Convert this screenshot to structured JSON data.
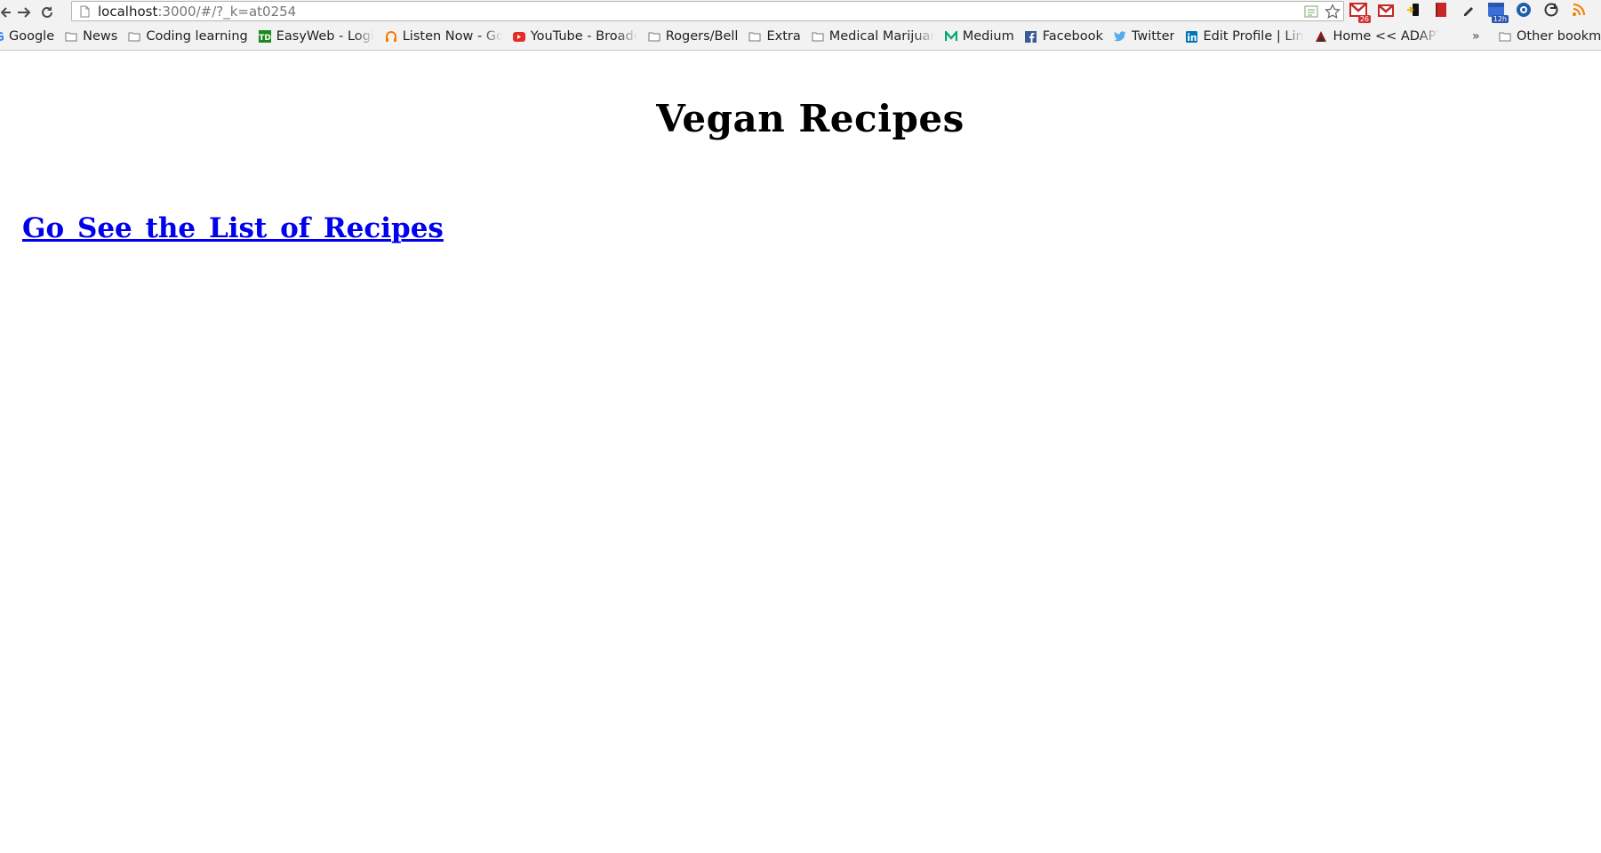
{
  "browser": {
    "url_host": "localhost",
    "url_rest": ":3000/#/?_k=at0254",
    "extensions": [
      {
        "name": "gmail",
        "badge": "26"
      },
      {
        "name": "gmail-alt"
      },
      {
        "name": "usb"
      },
      {
        "name": "book"
      },
      {
        "name": "pen"
      },
      {
        "name": "calendar",
        "badge": "12h"
      },
      {
        "name": "eye"
      },
      {
        "name": "sync"
      },
      {
        "name": "rss"
      }
    ],
    "colors": {
      "chrome_bg": "#f2f2f2",
      "link": "#0000ee"
    }
  },
  "bookmarks": {
    "items": [
      {
        "label": "Google",
        "icon": "google-icon"
      },
      {
        "label": "News",
        "icon": "folder-icon"
      },
      {
        "label": "Coding learning",
        "icon": "folder-icon"
      },
      {
        "label": "EasyWeb - Login I",
        "icon": "td-icon"
      },
      {
        "label": "Listen Now - Goo",
        "icon": "headphones-icon"
      },
      {
        "label": "YouTube - Broadc",
        "icon": "youtube-icon"
      },
      {
        "label": "Rogers/Bell",
        "icon": "folder-icon"
      },
      {
        "label": "Extra",
        "icon": "folder-icon"
      },
      {
        "label": "Medical Marijuan",
        "icon": "folder-icon"
      },
      {
        "label": "Medium",
        "icon": "medium-icon"
      },
      {
        "label": "Facebook",
        "icon": "facebook-icon"
      },
      {
        "label": "Twitter",
        "icon": "twitter-icon"
      },
      {
        "label": "Edit Profile | Link",
        "icon": "linkedin-icon"
      },
      {
        "label": "Home << ADAPTT",
        "icon": "adaptt-icon"
      }
    ],
    "overflow": "»",
    "other": "Other bookm"
  },
  "page": {
    "title": "Vegan Recipes",
    "link_text": "Go See the List of Recipes"
  }
}
